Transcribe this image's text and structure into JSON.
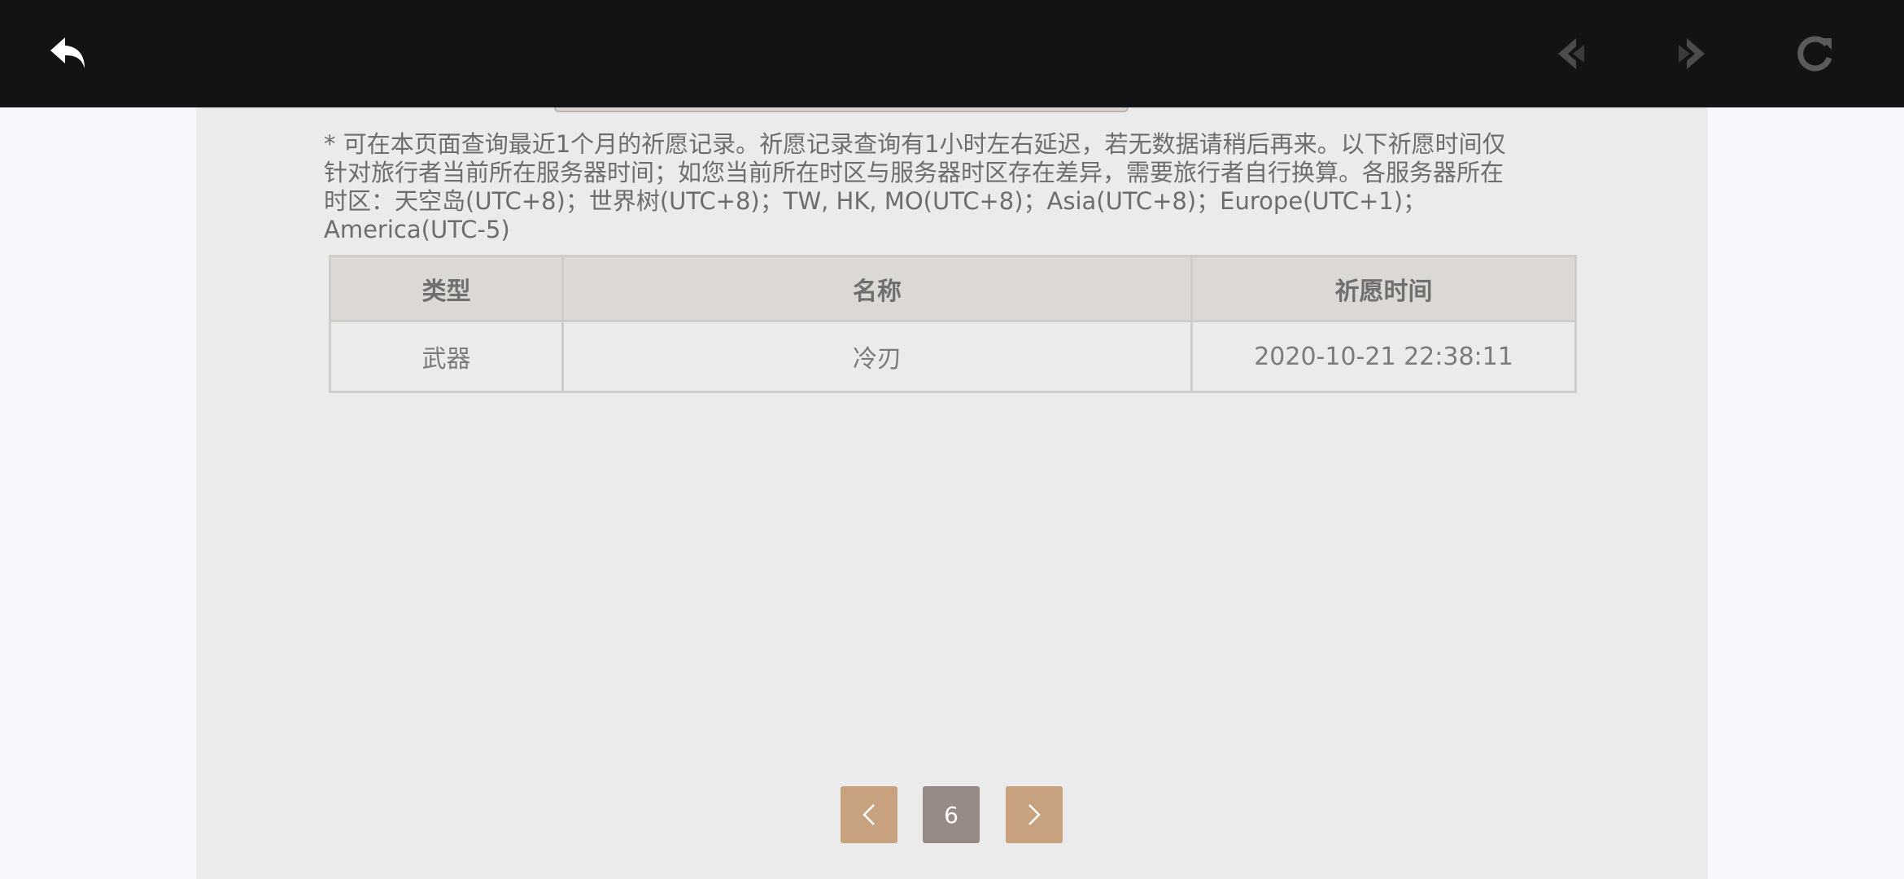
{
  "toolbar": {
    "back_icon": "back-arrow-icon",
    "prev_icon": "previous-page-icon",
    "next_icon": "next-page-icon",
    "reload_icon": "reload-icon"
  },
  "notice": "* 可在本页面查询最近1个月的祈愿记录。祈愿记录查询有1小时左右延迟，若无数据请稍后再来。以下祈愿时间仅\n针对旅行者当前所在服务器时间；如您当前所在时区与服务器时区存在差异，需要旅行者自行换算。各服务器所在\n时区：天空岛(UTC+8)；世界树(UTC+8)；TW, HK, MO(UTC+8)；Asia(UTC+8)；Europe(UTC+1)；America(UTC-5)",
  "table": {
    "headers": [
      "类型",
      "名称",
      "祈愿时间"
    ],
    "rows": [
      [
        "武器",
        "冷刃",
        "2020-10-21 22:38:11"
      ]
    ]
  },
  "pagination": {
    "prev": "<",
    "current": "6",
    "next": ">"
  },
  "colors": {
    "topbar": "#121315",
    "panel": "#ebebeb",
    "header_row": "#dcd9d5",
    "pager_accent": "#c8a27e",
    "pager_current": "#958b84"
  }
}
